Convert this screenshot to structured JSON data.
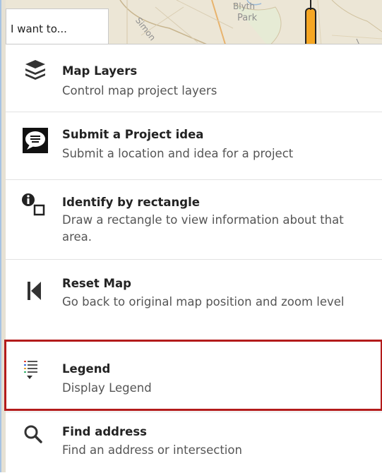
{
  "tab": {
    "label": "I want to..."
  },
  "map": {
    "park_label": "Park",
    "park_label_top": "Blyth",
    "road_label": "Simon"
  },
  "menu": [
    {
      "icon": "layers-icon",
      "title": "Map Layers",
      "desc": "Control map project layers"
    },
    {
      "icon": "speech-bubble-icon",
      "title": "Submit a Project idea",
      "desc": "Submit a location and idea for a project"
    },
    {
      "icon": "identify-rectangle-icon",
      "title": "Identify by rectangle",
      "desc": "Draw a rectangle to view information about that area."
    },
    {
      "icon": "reset-map-icon",
      "title": "Reset Map",
      "desc": "Go back to original map position and zoom level"
    },
    {
      "icon": "legend-icon",
      "title": "Legend",
      "desc": "Display Legend"
    },
    {
      "icon": "search-icon",
      "title": "Find address",
      "desc": "Find an address or intersection"
    }
  ],
  "colors": {
    "highlight": "#b31b1b",
    "accent_orange": "#f5a623"
  }
}
